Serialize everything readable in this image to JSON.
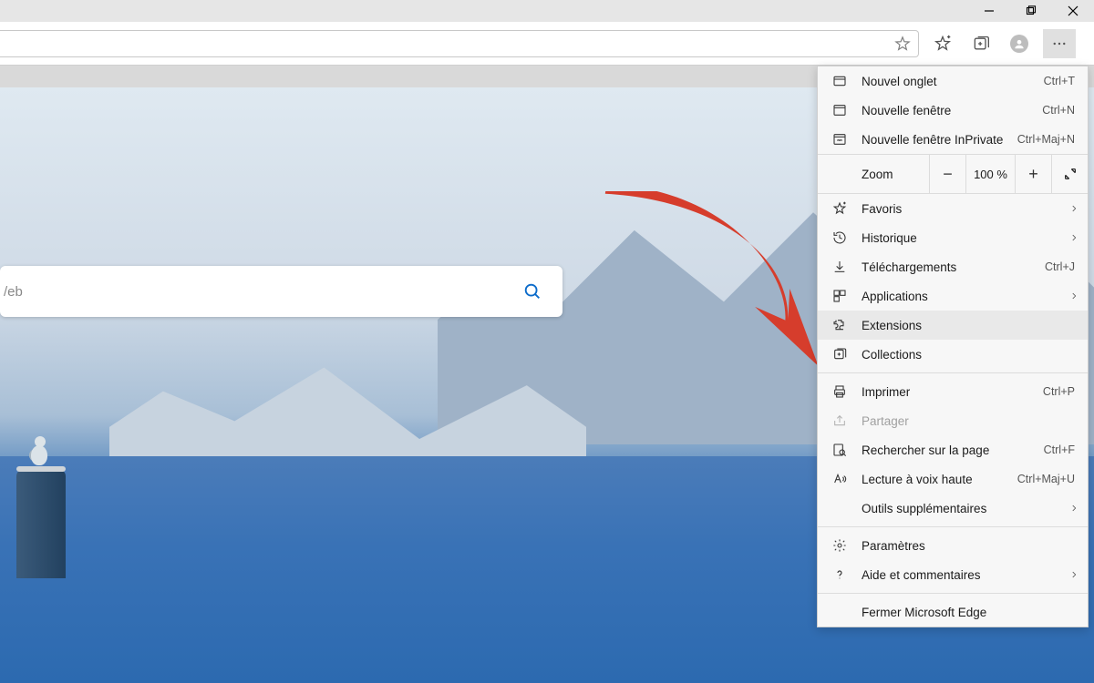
{
  "search": {
    "placeholder": "/eb"
  },
  "zoom": {
    "label": "Zoom",
    "value": "100 %"
  },
  "menu": {
    "new_tab": {
      "label": "Nouvel onglet",
      "shortcut": "Ctrl+T"
    },
    "new_window": {
      "label": "Nouvelle fenêtre",
      "shortcut": "Ctrl+N"
    },
    "new_inprivate": {
      "label": "Nouvelle fenêtre InPrivate",
      "shortcut": "Ctrl+Maj+N"
    },
    "favorites": {
      "label": "Favoris"
    },
    "history": {
      "label": "Historique"
    },
    "downloads": {
      "label": "Téléchargements",
      "shortcut": "Ctrl+J"
    },
    "apps": {
      "label": "Applications"
    },
    "extensions": {
      "label": "Extensions"
    },
    "collections": {
      "label": "Collections"
    },
    "print": {
      "label": "Imprimer",
      "shortcut": "Ctrl+P"
    },
    "share": {
      "label": "Partager"
    },
    "find": {
      "label": "Rechercher sur la page",
      "shortcut": "Ctrl+F"
    },
    "read_aloud": {
      "label": "Lecture à voix haute",
      "shortcut": "Ctrl+Maj+U"
    },
    "more_tools": {
      "label": "Outils supplémentaires"
    },
    "settings": {
      "label": "Paramètres"
    },
    "help": {
      "label": "Aide et commentaires"
    },
    "close": {
      "label": "Fermer Microsoft Edge"
    }
  }
}
